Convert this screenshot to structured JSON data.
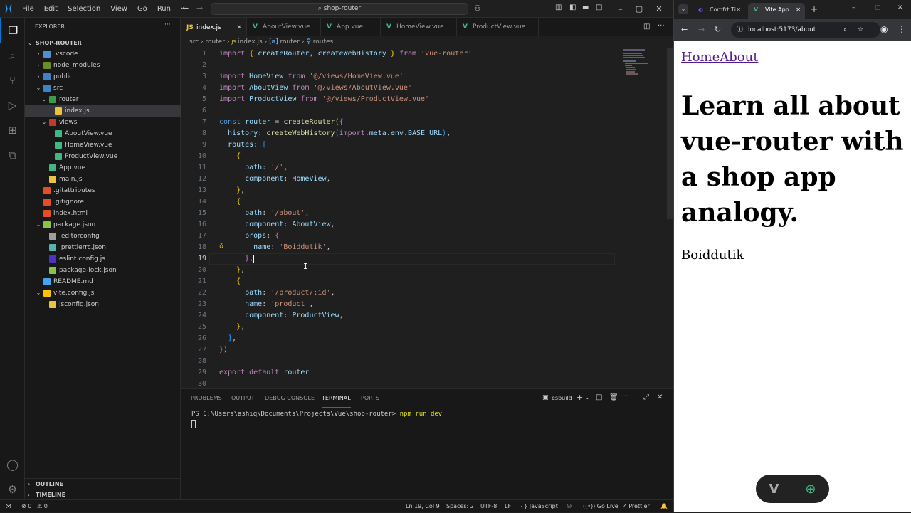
{
  "vscode": {
    "menu": [
      "File",
      "Edit",
      "Selection",
      "View",
      "Go",
      "Run",
      "···"
    ],
    "command_center": "shop-router",
    "explorer": {
      "title": "EXPLORER",
      "project": "SHOP-ROUTER",
      "items": [
        {
          "label": ".vscode",
          "indent": 1,
          "chev": "›",
          "color": "#4f8fd3"
        },
        {
          "label": "node_modules",
          "indent": 1,
          "chev": "›",
          "color": "#6b8e23"
        },
        {
          "label": "public",
          "indent": 1,
          "chev": "›",
          "color": "#3b84c7"
        },
        {
          "label": "src",
          "indent": 1,
          "chev": "⌄",
          "color": "#3b84c7"
        },
        {
          "label": "router",
          "indent": 2,
          "chev": "⌄",
          "color": "#3b9a4e"
        },
        {
          "label": "index.js",
          "indent": 3,
          "chev": "",
          "color": "#e8c33b"
        },
        {
          "label": "views",
          "indent": 2,
          "chev": "⌄",
          "color": "#c0392b"
        },
        {
          "label": "AboutView.vue",
          "indent": 3,
          "chev": "",
          "color": "#41b883"
        },
        {
          "label": "HomeView.vue",
          "indent": 3,
          "chev": "",
          "color": "#41b883"
        },
        {
          "label": "ProductView.vue",
          "indent": 3,
          "chev": "",
          "color": "#41b883"
        },
        {
          "label": "App.vue",
          "indent": 2,
          "chev": "",
          "color": "#41b883"
        },
        {
          "label": "main.js",
          "indent": 2,
          "chev": "",
          "color": "#e8c33b"
        },
        {
          "label": ".gitattributes",
          "indent": 1,
          "chev": "",
          "color": "#e44d26"
        },
        {
          "label": ".gitignore",
          "indent": 1,
          "chev": "",
          "color": "#e44d26"
        },
        {
          "label": "index.html",
          "indent": 1,
          "chev": "",
          "color": "#e44d26"
        },
        {
          "label": "package.json",
          "indent": 1,
          "chev": "⌄",
          "color": "#8bc34a"
        },
        {
          "label": ".editorconfig",
          "indent": 2,
          "chev": "",
          "color": "#9e9e9e"
        },
        {
          "label": ".prettierrc.json",
          "indent": 2,
          "chev": "",
          "color": "#56b3b4"
        },
        {
          "label": "eslint.config.js",
          "indent": 2,
          "chev": "",
          "color": "#4b32c3"
        },
        {
          "label": "package-lock.json",
          "indent": 2,
          "chev": "",
          "color": "#8bc34a"
        },
        {
          "label": "README.md",
          "indent": 1,
          "chev": "",
          "color": "#42a5f5"
        },
        {
          "label": "vite.config.js",
          "indent": 1,
          "chev": "⌄",
          "color": "#ffc107"
        },
        {
          "label": "jsconfig.json",
          "indent": 2,
          "chev": "",
          "color": "#e8c33b"
        }
      ],
      "outline": "OUTLINE",
      "timeline": "TIMELINE"
    },
    "tabs": [
      {
        "label": "index.js",
        "active": true,
        "icon": "js-icon"
      },
      {
        "label": "AboutView.vue",
        "active": false,
        "icon": "vue-icon"
      },
      {
        "label": "App.vue",
        "active": false,
        "icon": "vue-icon"
      },
      {
        "label": "HomeView.vue",
        "active": false,
        "icon": "vue-icon"
      },
      {
        "label": "ProductView.vue",
        "active": false,
        "icon": "vue-icon"
      }
    ],
    "breadcrumb": [
      "src",
      "router",
      "index.js",
      "router",
      "routes"
    ],
    "code_lines": [
      "1",
      "2",
      "3",
      "4",
      "5",
      "6",
      "7",
      "8",
      "9",
      "10",
      "11",
      "12",
      "13",
      "14",
      "15",
      "16",
      "17",
      "18",
      "19",
      "20",
      "21",
      "22",
      "23",
      "24",
      "25",
      "26",
      "27",
      "28",
      "29",
      "30"
    ],
    "panel_tabs": [
      "PROBLEMS",
      "OUTPUT",
      "DEBUG CONSOLE",
      "TERMINAL",
      "PORTS"
    ],
    "terminal_shell": "esbuild",
    "terminal_prompt": "PS C:\\Users\\ashiq\\Documents\\Projects\\Vue\\shop-router>",
    "terminal_cmd": "npm run dev",
    "status": {
      "errors": "0",
      "warnings": "0",
      "position": "Ln 19, Col 9",
      "spaces": "Spaces: 2",
      "encoding": "UTF-8",
      "eol": "LF",
      "language": "JavaScript",
      "golive": "Go Live",
      "prettier": "Prettier"
    }
  },
  "browser": {
    "tabs": [
      {
        "label": "Comfrt Ti",
        "active": false
      },
      {
        "label": "Vite App",
        "active": true
      }
    ],
    "url": "localhost:5173/about",
    "page": {
      "nav_home": "Home",
      "nav_about": "About",
      "heading": "Learn all about vue-router with a shop app analogy.",
      "prop_name": "Boiddutik"
    }
  }
}
